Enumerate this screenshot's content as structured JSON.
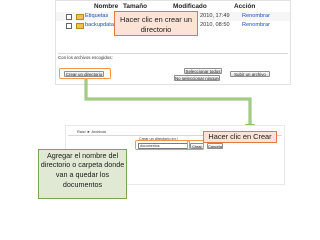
{
  "top_panel": {
    "columns": {
      "name": "Nombre",
      "size": "Tamaño",
      "modified": "Modificado",
      "action": "Acción"
    },
    "rows": [
      {
        "name": "Etiquetas",
        "modified": "2010, 17:49",
        "action": "Renombrar"
      },
      {
        "name": "backupdata",
        "modified": "2010, 08:50",
        "action": "Renombrar"
      }
    ],
    "selected_label": "Con los archivos escogidos:",
    "buttons": {
      "create_folder": "Crear un directorio",
      "select_all": "Seleccionar todos",
      "select_none": "No seleccionar ninguno",
      "upload": "Subir un archivo"
    }
  },
  "callouts": {
    "create_folder": "Hacer clic en crear un directorio",
    "click_create": "Hacer clic en Crear",
    "name_folder": "Agregar el nombre del directorio o carpeta donde van a quedar los documentos"
  },
  "bottom_panel": {
    "breadcrumb": "Raíz/ ► Archivos",
    "form_label": "Crear un directorio en /",
    "input_value": "documentos",
    "create_button": "Crear",
    "cancel_button": "Cancelar"
  },
  "colors": {
    "callout_fill": "#fbe4d6",
    "callout_border": "#e07b49",
    "highlight": "#f79646",
    "side_fill": "#dfe9d3",
    "side_border": "#7aa557",
    "link": "#1d4fb8"
  }
}
